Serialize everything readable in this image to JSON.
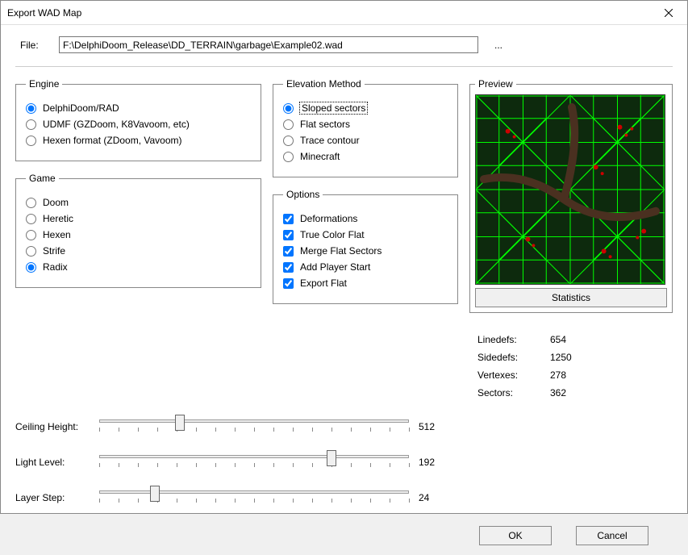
{
  "window": {
    "title": "Export WAD Map"
  },
  "file": {
    "label": "File:",
    "path": "F:\\DelphiDoom_Release\\DD_TERRAIN\\garbage\\Example02.wad",
    "browse": "..."
  },
  "groups": {
    "engine": {
      "legend": "Engine",
      "options": [
        {
          "label": "DelphiDoom/RAD",
          "checked": true
        },
        {
          "label": "UDMF (GZDoom, K8Vavoom, etc)",
          "checked": false
        },
        {
          "label": "Hexen format (ZDoom, Vavoom)",
          "checked": false
        }
      ]
    },
    "game": {
      "legend": "Game",
      "options": [
        {
          "label": "Doom",
          "checked": false
        },
        {
          "label": "Heretic",
          "checked": false
        },
        {
          "label": "Hexen",
          "checked": false
        },
        {
          "label": "Strife",
          "checked": false
        },
        {
          "label": "Radix",
          "checked": true
        }
      ]
    },
    "elevation": {
      "legend": "Elevation Method",
      "options": [
        {
          "label": "Sloped sectors",
          "checked": true,
          "focus": true
        },
        {
          "label": "Flat sectors",
          "checked": false
        },
        {
          "label": "Trace contour",
          "checked": false
        },
        {
          "label": "Minecraft",
          "checked": false
        }
      ]
    },
    "options": {
      "legend": "Options",
      "items": [
        {
          "label": "Deformations",
          "checked": true
        },
        {
          "label": "True Color Flat",
          "checked": true
        },
        {
          "label": "Merge Flat Sectors",
          "checked": true
        },
        {
          "label": "Add Player Start",
          "checked": true
        },
        {
          "label": "Export Flat",
          "checked": true
        }
      ]
    }
  },
  "sliders": {
    "ceiling": {
      "label": "Ceiling Height:",
      "value": "512",
      "pos": 26
    },
    "light": {
      "label": "Light Level:",
      "value": "192",
      "pos": 75
    },
    "layer": {
      "label": "Layer Step:",
      "value": "24",
      "pos": 18
    }
  },
  "preview": {
    "legend": "Preview",
    "stats_button": "Statistics"
  },
  "stats": {
    "linedefs": {
      "label": "Linedefs:",
      "value": "654"
    },
    "sidedefs": {
      "label": "Sidedefs:",
      "value": "1250"
    },
    "vertexes": {
      "label": "Vertexes:",
      "value": "278"
    },
    "sectors": {
      "label": "Sectors:",
      "value": "362"
    }
  },
  "buttons": {
    "ok": "OK",
    "cancel": "Cancel"
  }
}
